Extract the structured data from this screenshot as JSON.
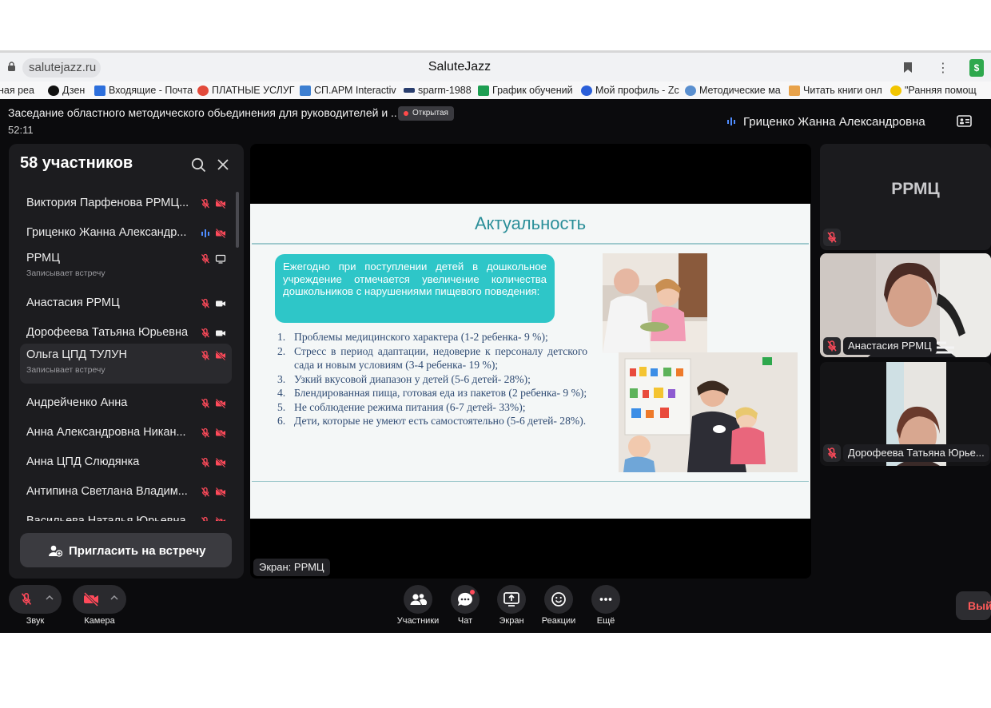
{
  "browser": {
    "url": "salutejazz.ru",
    "page_title": "SaluteJazz",
    "bookmarks": [
      "ная реа",
      "Дзен",
      "Входящие - Почта",
      "ПЛАТНЫЕ УСЛУГ",
      "СП.АРМ Interactiv",
      "sparm-1988",
      "График обучений",
      "Мой профиль - Zc",
      "Методические ма",
      "Читать книги онл",
      "\"Ранняя помощ"
    ]
  },
  "meeting": {
    "title": "Заседание областного методического обьединения для руководителей и ...",
    "badge": "Открытая",
    "timer": "52:11",
    "active_speaker": "Гриценко Жанна Александровна"
  },
  "participants_panel": {
    "title": "58 участников",
    "rows": [
      {
        "name": "Виктория Парфенова РРМЦ...",
        "sub": "",
        "mic": "muted",
        "video": "off"
      },
      {
        "name": "Гриценко Жанна Александр...",
        "sub": "",
        "mic": "speaking",
        "video": "off"
      },
      {
        "name": "РРМЦ",
        "sub": "Записывает встречу",
        "mic": "muted",
        "video": "screen"
      },
      {
        "name": "Анастасия РРМЦ",
        "sub": "",
        "mic": "muted",
        "video": "on"
      },
      {
        "name": "Дорофеева Татьяна Юрьевна",
        "sub": "",
        "mic": "muted",
        "video": "on"
      },
      {
        "name": "Ольга ЦПД ТУЛУН",
        "sub": "Записывает встречу",
        "mic": "muted",
        "video": "off"
      },
      {
        "name": "Андрейченко Анна",
        "sub": "",
        "mic": "muted",
        "video": "off"
      },
      {
        "name": "Анна Александровна Никан...",
        "sub": "",
        "mic": "muted",
        "video": "off"
      },
      {
        "name": "Анна ЦПД Слюдянка",
        "sub": "",
        "mic": "muted",
        "video": "off"
      },
      {
        "name": "Антипина Светлана Владим...",
        "sub": "",
        "mic": "muted",
        "video": "off"
      },
      {
        "name": "Васильева Наталья Юрьевна",
        "sub": "",
        "mic": "muted",
        "video": "off"
      }
    ],
    "invite_label": "Пригласить на встречу"
  },
  "slide": {
    "title": "Актуальность",
    "callout": "Ежегодно при поступлении детей в дошкольное учреждение отмечается увеличение количества дошкольников с нарушениями пищевого поведения:",
    "items": [
      {
        "num": "1.",
        "text": "Проблемы медицинского характера (1-2 ребенка- 9 %);"
      },
      {
        "num": "2.",
        "text": "Стресс в период адаптации, недоверие к персоналу детского сада и новым условиям (3-4 ребенка- 19 %);"
      },
      {
        "num": "3.",
        "text": "Узкий вкусовой диапазон у детей (5-6 детей- 28%);"
      },
      {
        "num": "4.",
        "text": "Блендированная пища, готовая еда из пакетов (2 ребенка- 9 %);"
      },
      {
        "num": "5.",
        "text": "Не соблюдение режима питания (6-7 детей- 33%);"
      },
      {
        "num": "6.",
        "text": "Дети, которые не умеют есть самостоятельно (5-6 детей- 28%)."
      }
    ]
  },
  "screen_label": "Экран: РРМЦ",
  "tiles": [
    {
      "name": "РРМЦ"
    },
    {
      "name": "Анастасия РРМЦ"
    },
    {
      "name": "Дорофеева Татьяна Юрье..."
    }
  ],
  "toolbar": {
    "sound": "Звук",
    "camera": "Камера",
    "participants": "Участники",
    "chat": "Чат",
    "screen": "Экран",
    "reactions": "Реакции",
    "more": "Ещё",
    "leave": "Вый"
  },
  "colors": {
    "accent_teal": "#2ec6c8",
    "slide_title": "#2b8f99",
    "muted_red": "#ff4a5a",
    "app_bg": "#0b0b0d"
  }
}
